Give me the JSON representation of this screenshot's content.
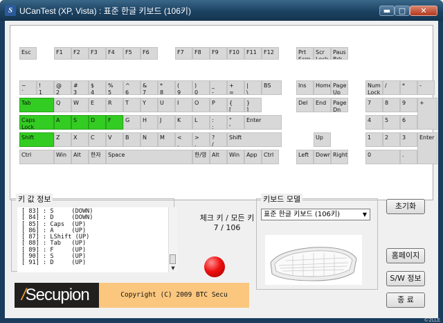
{
  "window": {
    "title": "UCanTest (XP, Vista) : 표준 한글 키보드 (106키)",
    "app_icon": "S",
    "controls": {
      "minimize": "▬",
      "maximize": "□",
      "close": "✕"
    }
  },
  "keyboard": {
    "pressed_color": "#33cc22",
    "keys": [
      {
        "label": "Esc",
        "on": false
      },
      {
        "label": "F1",
        "on": false
      },
      {
        "label": "F2",
        "on": false
      },
      {
        "label": "F3",
        "on": false
      },
      {
        "label": "F4",
        "on": false
      },
      {
        "label": "F5",
        "on": false
      },
      {
        "label": "F6",
        "on": false
      },
      {
        "label": "F7",
        "on": false
      },
      {
        "label": "F8",
        "on": false
      },
      {
        "label": "F9",
        "on": false
      },
      {
        "label": "F10",
        "on": false
      },
      {
        "label": "F11",
        "on": false
      },
      {
        "label": "F12",
        "on": false
      },
      {
        "label": "Prt\nScrn",
        "on": false
      },
      {
        "label": "Scr\nLock",
        "on": false
      },
      {
        "label": "Paus\nBrk",
        "on": false
      },
      {
        "label": "~\n`",
        "on": false
      },
      {
        "label": "!\n1",
        "on": false
      },
      {
        "label": "@\n2",
        "on": false
      },
      {
        "label": "#\n3",
        "on": false
      },
      {
        "label": "$\n4",
        "on": false
      },
      {
        "label": "%\n5",
        "on": false
      },
      {
        "label": "^\n6",
        "on": false
      },
      {
        "label": "&\n7",
        "on": false
      },
      {
        "label": "*\n8",
        "on": false
      },
      {
        "label": "(\n9",
        "on": false
      },
      {
        "label": ")\n0",
        "on": false
      },
      {
        "label": "_\n-",
        "on": false
      },
      {
        "label": "+\n=",
        "on": false
      },
      {
        "label": "|\n\\",
        "on": false
      },
      {
        "label": "BS",
        "on": false
      },
      {
        "label": "Ins",
        "on": false
      },
      {
        "label": "Home",
        "on": false
      },
      {
        "label": "Page\nUp",
        "on": false
      },
      {
        "label": "Num\nLock",
        "on": false
      },
      {
        "label": "/",
        "on": false
      },
      {
        "label": "*",
        "on": false
      },
      {
        "label": "-",
        "on": false
      },
      {
        "label": "Tab",
        "on": true
      },
      {
        "label": "Q",
        "on": false
      },
      {
        "label": "W",
        "on": false
      },
      {
        "label": "E",
        "on": false
      },
      {
        "label": "R",
        "on": false
      },
      {
        "label": "T",
        "on": false
      },
      {
        "label": "Y",
        "on": false
      },
      {
        "label": "U",
        "on": false
      },
      {
        "label": "I",
        "on": false
      },
      {
        "label": "O",
        "on": false
      },
      {
        "label": "P",
        "on": false
      },
      {
        "label": "{\n[",
        "on": false
      },
      {
        "label": "}\n]",
        "on": false
      },
      {
        "label": "Del",
        "on": false
      },
      {
        "label": "End",
        "on": false
      },
      {
        "label": "Page\nDn",
        "on": false
      },
      {
        "label": "7",
        "on": false
      },
      {
        "label": "8",
        "on": false
      },
      {
        "label": "9",
        "on": false
      },
      {
        "label": "+",
        "on": false
      },
      {
        "label": "Caps\nLock",
        "on": true
      },
      {
        "label": "A",
        "on": true
      },
      {
        "label": "S",
        "on": true
      },
      {
        "label": "D",
        "on": true
      },
      {
        "label": "F",
        "on": true
      },
      {
        "label": "G",
        "on": false
      },
      {
        "label": "H",
        "on": false
      },
      {
        "label": "J",
        "on": false
      },
      {
        "label": "K",
        "on": false
      },
      {
        "label": "L",
        "on": false
      },
      {
        "label": ":\n;",
        "on": false
      },
      {
        "label": "\"\n'",
        "on": false
      },
      {
        "label": "Enter",
        "on": false
      },
      {
        "label": "4",
        "on": false
      },
      {
        "label": "5",
        "on": false
      },
      {
        "label": "6",
        "on": false
      },
      {
        "label": "Shift",
        "on": true
      },
      {
        "label": "Z",
        "on": false
      },
      {
        "label": "X",
        "on": false
      },
      {
        "label": "C",
        "on": false
      },
      {
        "label": "V",
        "on": false
      },
      {
        "label": "B",
        "on": false
      },
      {
        "label": "N",
        "on": false
      },
      {
        "label": "M",
        "on": false
      },
      {
        "label": "<\n,",
        "on": false
      },
      {
        "label": ">\n.",
        "on": false
      },
      {
        "label": "?\n/",
        "on": false
      },
      {
        "label": "Shift",
        "on": false
      },
      {
        "label": "Up",
        "on": false
      },
      {
        "label": "1",
        "on": false
      },
      {
        "label": "2",
        "on": false
      },
      {
        "label": "3",
        "on": false
      },
      {
        "label": "Enter",
        "on": false
      },
      {
        "label": "Ctrl",
        "on": false
      },
      {
        "label": "Win",
        "on": false
      },
      {
        "label": "Alt",
        "on": false
      },
      {
        "label": "한자",
        "on": false
      },
      {
        "label": "Space",
        "on": false
      },
      {
        "label": "한/영",
        "on": false
      },
      {
        "label": "Alt",
        "on": false
      },
      {
        "label": "Win",
        "on": false
      },
      {
        "label": "App",
        "on": false
      },
      {
        "label": "Ctrl",
        "on": false
      },
      {
        "label": "Left",
        "on": false
      },
      {
        "label": "Down",
        "on": false
      },
      {
        "label": "Right",
        "on": false
      },
      {
        "label": "0",
        "on": false
      },
      {
        "label": ".",
        "on": false
      }
    ]
  },
  "key_info": {
    "title": "키 값 정보",
    "lines": [
      "[ 83] : S     (DOWN)",
      "[ 84] : D     (DOWN)",
      "[ 85] : Caps  (UP)",
      "[ 86] : A     (UP)",
      "[ 87] : LShift (UP)",
      "[ 88] : Tab   (UP)",
      "[ 89] : F     (UP)",
      "[ 90] : S     (UP)",
      "[ 91] : D     (UP)"
    ]
  },
  "status": {
    "label": "체크 키 / 모든 키",
    "checked": 7,
    "total": 106,
    "count_text": "7 / 106",
    "indicator_color": "#ee1010"
  },
  "model": {
    "title": "키보드 모델",
    "selected": "표준 한글 키보드 (106키)",
    "arrow": "▼"
  },
  "buttons": {
    "reset": "초기화",
    "homepage": "홈페이지",
    "sw_info": "S/W 정보",
    "exit": "종  료"
  },
  "banner": {
    "logo_slash": "/",
    "logo_text": "Secupion",
    "copyright": "Copyright (C) 2009 BTC Secu"
  },
  "watermark": "©2LLE"
}
